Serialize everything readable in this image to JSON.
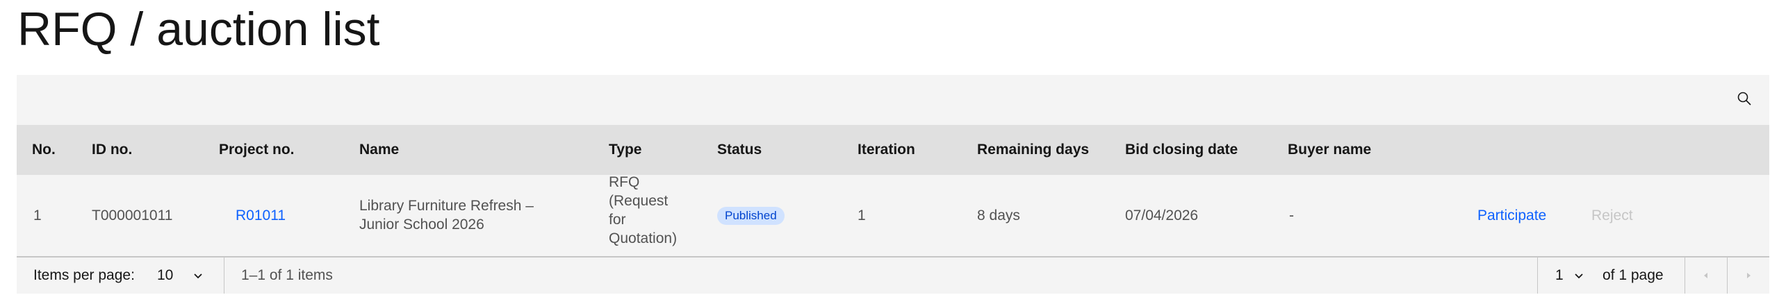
{
  "page": {
    "title": "RFQ / auction list"
  },
  "table": {
    "columns": {
      "no": "No.",
      "id": "ID no.",
      "project": "Project no.",
      "name": "Name",
      "type": "Type",
      "status": "Status",
      "iteration": "Iteration",
      "remaining": "Remaining days",
      "closing": "Bid closing date",
      "buyer": "Buyer name"
    },
    "rows": [
      {
        "no": "1",
        "id": "T000001011",
        "project": "R01011",
        "name_line1": "Library Furniture Refresh –",
        "name_line2": "Junior School 2026",
        "type_line1": "RFQ",
        "type_line2": "(Request",
        "type_line3": "for",
        "type_line4": "Quotation)",
        "status": "Published",
        "iteration": "1",
        "remaining": "8 days",
        "closing": "07/04/2026",
        "buyer": "-",
        "participate_label": "Participate",
        "reject_label": "Reject"
      }
    ]
  },
  "pagination": {
    "items_per_page_label": "Items per page:",
    "items_per_page_value": "10",
    "range_text": "1–1 of 1 items",
    "current_page": "1",
    "total_pages_text": "of 1 page"
  },
  "icons": {
    "search": "search-icon",
    "chevron": "chevron-down-icon",
    "prev": "caret-left-icon",
    "next": "caret-right-icon"
  },
  "colors": {
    "link": "#0f62fe",
    "tag_bg": "#d0e2ff",
    "tag_text": "#0043ce",
    "header_bg": "#e0e0e0",
    "table_bg": "#f4f4f4"
  }
}
